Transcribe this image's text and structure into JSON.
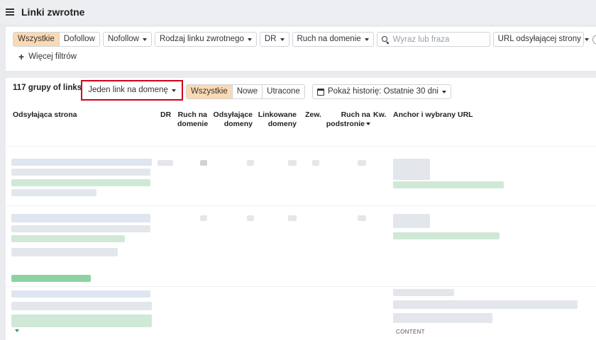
{
  "header": {
    "title": "Linki zwrotne"
  },
  "filters": {
    "link_type_segment": [
      "Wszystkie",
      "Dofollow"
    ],
    "nofollow": "Nofollow",
    "backlink_type": "Rodzaj linku zwrotnego",
    "dr": "DR",
    "domain_traffic": "Ruch na domenie",
    "search": {
      "placeholder": "Wyraz lub fraza",
      "value": ""
    },
    "referring_url": "URL odsyłającej strony",
    "more_filters": "Więcej filtrów"
  },
  "results": {
    "count": "117 grupy of links",
    "grouping": "Jeden link na domenę",
    "status_segment": [
      "Wszystkie",
      "Nowe",
      "Utracone"
    ],
    "history": "Pokaż historię: Ostatnie 30 dni",
    "columns": {
      "referring_page": "Odsyłająca strona",
      "dr": "DR",
      "domain_traffic": [
        "Ruch na",
        "domenie"
      ],
      "referring_domains": [
        "Odsyłające",
        "domeny"
      ],
      "linked_domains": [
        "Linkowane",
        "domeny"
      ],
      "external": "Zew.",
      "page_traffic": [
        "Ruch na",
        "podstronie"
      ],
      "kw": "Kw.",
      "anchor": "Anchor i wybrany URL"
    },
    "content_tag": "CONTENT"
  },
  "colors": {
    "accent_active": "#fbd9b3",
    "highlight_border": "#d0021b",
    "link_green": "#8cd3a3"
  }
}
